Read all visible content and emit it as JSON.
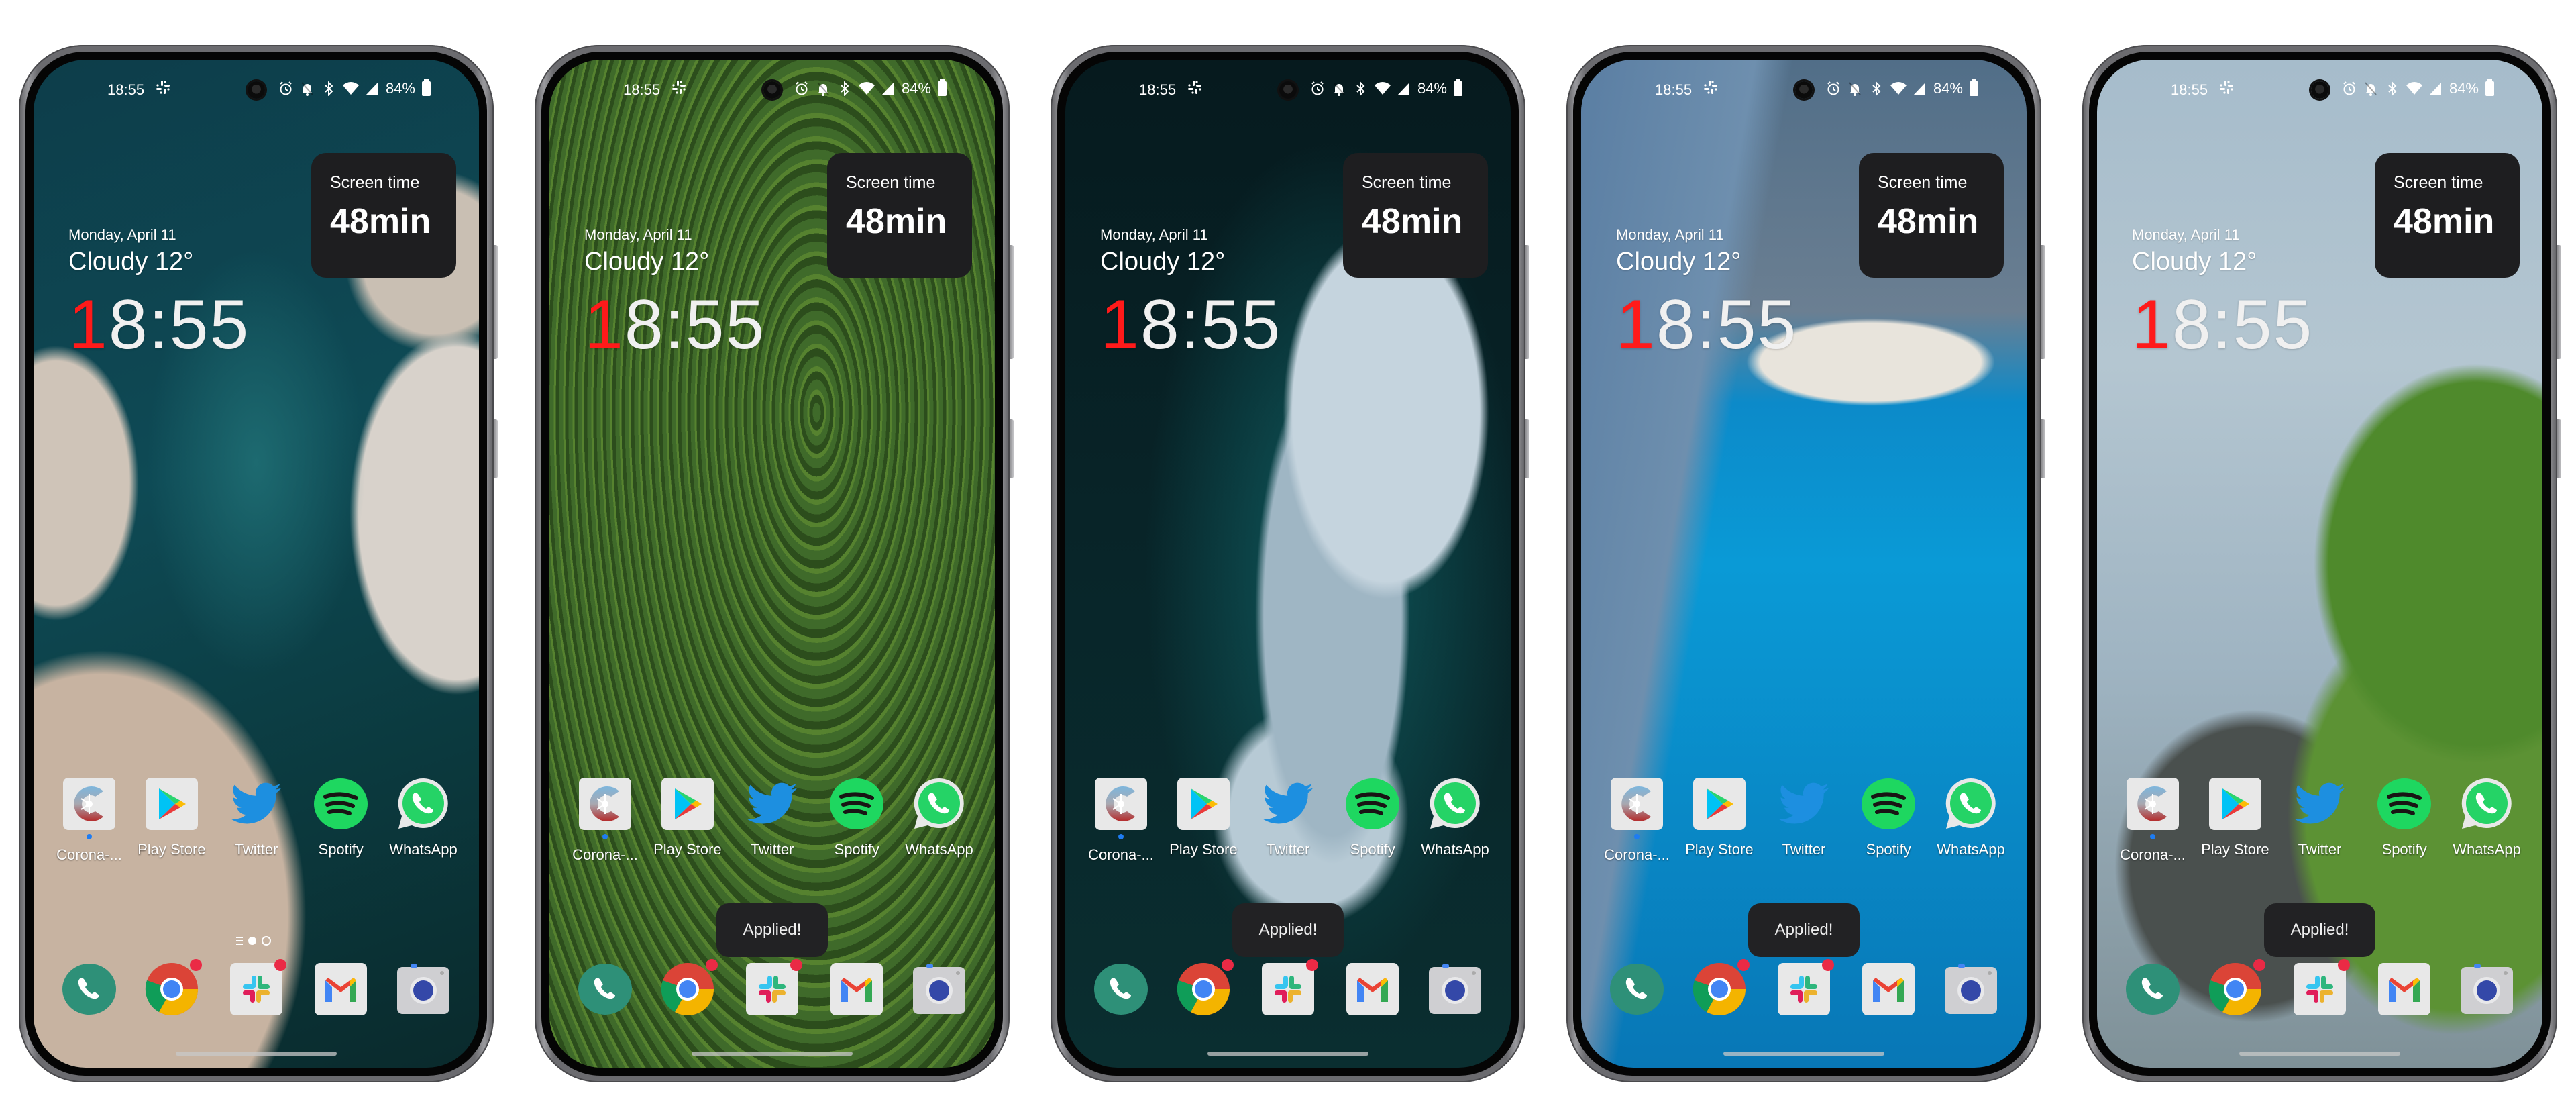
{
  "status_bar": {
    "time": "18:55",
    "notification_icon": "slack-icon",
    "icons": [
      "alarm-icon",
      "bell-off-icon",
      "bluetooth-icon",
      "wifi-icon",
      "signal-icon"
    ],
    "battery_percent": "84%"
  },
  "screen_time_widget": {
    "label": "Screen time",
    "value": "48min"
  },
  "date_weather": {
    "date": "Monday, April 11",
    "weather": "Cloudy 12°"
  },
  "clock": {
    "first_digit": "1",
    "rest": "8:55"
  },
  "apps": [
    {
      "label": "Corona-...",
      "icon": "corona-warn-app-icon",
      "has_dot": true
    },
    {
      "label": "Play Store",
      "icon": "play-store-icon"
    },
    {
      "label": "Twitter",
      "icon": "twitter-icon"
    },
    {
      "label": "Spotify",
      "icon": "spotify-icon"
    },
    {
      "label": "WhatsApp",
      "icon": "whatsapp-icon"
    }
  ],
  "dock": [
    {
      "name": "Phone",
      "icon": "phone-icon"
    },
    {
      "name": "Chrome",
      "icon": "chrome-icon",
      "badge": true
    },
    {
      "name": "Slack",
      "icon": "slack-icon",
      "badge": true
    },
    {
      "name": "Gmail",
      "icon": "gmail-icon"
    },
    {
      "name": "Camera",
      "icon": "camera-icon"
    }
  ],
  "toast": {
    "text": "Applied!"
  },
  "phones": [
    {
      "wallpaper": "turquoise sea with rocky cliffs",
      "show_toast": false,
      "show_page_dots": true
    },
    {
      "wallpaper": "green rice terraces",
      "show_toast": true,
      "show_page_dots": false
    },
    {
      "wallpaper": "dark teal with white fabric shape",
      "show_toast": true,
      "show_page_dots": false
    },
    {
      "wallpaper": "blue bay with white beach and shipwreck",
      "show_toast": true,
      "show_page_dots": false
    },
    {
      "wallpaper": "misty green mountain cliff",
      "show_toast": true,
      "show_page_dots": false
    }
  ],
  "colors": {
    "clock_accent": "#ff1a1a",
    "widget_bg": "#1e1e20",
    "toast_bg": "#222224",
    "badge": "#ea2a45",
    "notification_dot": "#1e7cf2"
  }
}
